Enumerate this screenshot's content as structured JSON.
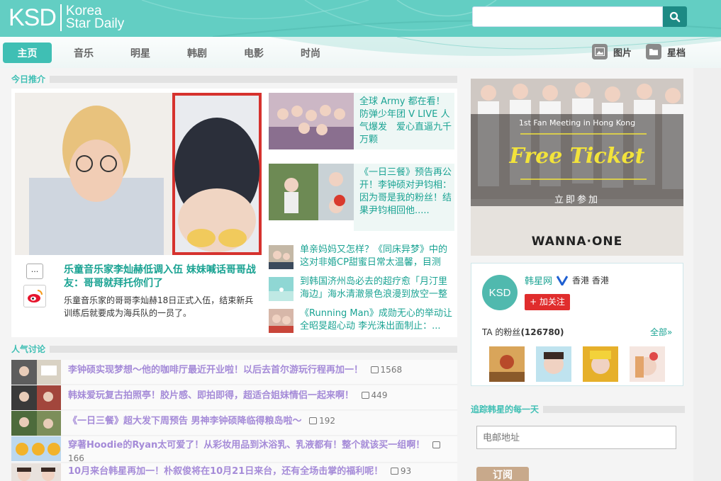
{
  "header": {
    "logo_short": "KSD",
    "logo_line1": "Korea",
    "logo_line2": "Star Daily",
    "search_value": ""
  },
  "nav": {
    "items": [
      {
        "label": "主页",
        "active": true
      },
      {
        "label": "音乐"
      },
      {
        "label": "明星"
      },
      {
        "label": "韩剧"
      },
      {
        "label": "电影"
      },
      {
        "label": "时尚"
      }
    ],
    "photos_label": "图片",
    "archive_label": "星档"
  },
  "today": {
    "section_title": "今日推介",
    "featured": {
      "title": "乐童音乐家李灿赫低调入伍 妹妹喊话哥哥战友：哥哥就拜托你们了",
      "desc": "乐童音乐家的哥哥李灿赫18日正式入伍，结束新兵训练后就要成为海兵队的一员了。",
      "more_label": "..."
    },
    "side_items": [
      {
        "text": "全球 Army 都在看！防弹少年团 V LIVE 人气爆发　爱心直逼九千万颗"
      },
      {
        "text": "《一日三餐》预告再公开！李钟硕对尹钧相：因为哥是我的粉丝！结果尹钧相回他....."
      }
    ],
    "small_items": [
      {
        "text": "单亲妈妈又怎样？《同床异梦》中的这对非婚CP甜蜜日常太温馨，目测"
      },
      {
        "text": "到韩国济州岛必去的超疗愈「月汀里海边」海水清澈景色浪漫到放空一整"
      },
      {
        "text": "《Running Man》成勋无心的举动让全昭旻超心动 李光洙出面制止：..."
      }
    ]
  },
  "popular": {
    "section_title": "人气讨论",
    "rows": [
      {
        "text": "李钟硕实现梦想～他的咖啡厅最近开业啦！以后去首尔游玩行程再加一！",
        "count": "1568"
      },
      {
        "text": "韩妹爱玩复古拍照亭！胶片感、即拍即得，超适合姐妹情侣一起来啊！",
        "count": "449"
      },
      {
        "text": "《一日三餐》超大发下周预告 男神李钟硕降临得粮岛啦～",
        "count": "192"
      },
      {
        "text": "穿著Hoodie的Ryan太可爱了！从彩妆用品到沐浴乳、乳液都有！整个就该买一组啊！",
        "count": "166"
      },
      {
        "text": "10月来台韩星再加一！朴叙俊将在10月21日来台，还有全场击掌的福利呢！",
        "count": "93"
      }
    ]
  },
  "banner": {
    "subtitle": "1st Fan Meeting in Hong Kong",
    "headline": "Free Ticket",
    "cta": "立即参加",
    "brand": "WANNA·ONE"
  },
  "profile": {
    "name": "韩星网",
    "location": "香港 香港",
    "follow_label": "+ 加关注",
    "fans_label": "TA 的粉丝",
    "fans_count": "(126780)",
    "all_label": "全部»",
    "avatar_text": "KSD"
  },
  "subscribe": {
    "title": "追踪韩星的每一天",
    "email_placeholder": "电邮地址",
    "button_label": "订阅"
  },
  "colors": {
    "accent": "#3fbfb4",
    "link": "#1aa393",
    "discussion": "#a58bd8"
  }
}
